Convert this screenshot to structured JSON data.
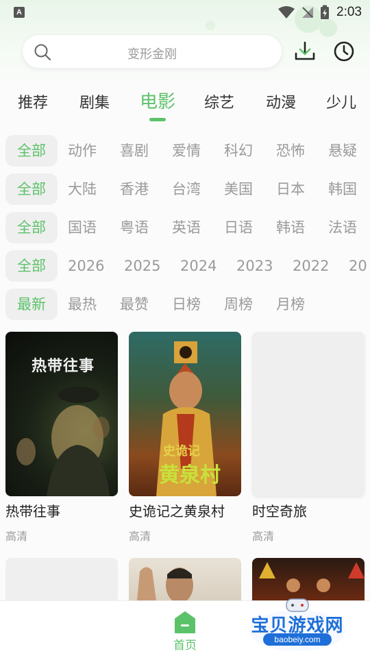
{
  "status_bar": {
    "time": "2:03"
  },
  "search": {
    "placeholder": "变形金刚"
  },
  "tabs": [
    {
      "label": "推荐"
    },
    {
      "label": "剧集"
    },
    {
      "label": "电影"
    },
    {
      "label": "综艺"
    },
    {
      "label": "动漫"
    },
    {
      "label": "少儿"
    }
  ],
  "active_tab": "电影",
  "filters": {
    "genre": [
      "全部",
      "动作",
      "喜剧",
      "爱情",
      "科幻",
      "恐怖",
      "悬疑"
    ],
    "region": [
      "全部",
      "大陆",
      "香港",
      "台湾",
      "美国",
      "日本",
      "韩国"
    ],
    "language": [
      "全部",
      "国语",
      "粤语",
      "英语",
      "日语",
      "韩语",
      "法语"
    ],
    "year": [
      "全部",
      "2026",
      "2025",
      "2024",
      "2023",
      "2022",
      "20"
    ],
    "sort": [
      "最新",
      "最热",
      "最赞",
      "日榜",
      "周榜",
      "月榜"
    ]
  },
  "movies": [
    {
      "title": "热带往事",
      "quality": "高清",
      "poster_text": "热带往事"
    },
    {
      "title": "史诡记之黄泉村",
      "quality": "高清",
      "poster_text_top": "史诡记",
      "poster_text_main": "黄泉村"
    },
    {
      "title": "时空奇旅",
      "quality": "高清"
    }
  ],
  "bottom_nav": {
    "home_label": "首页"
  },
  "watermark": {
    "title": "宝贝游戏网",
    "url": "baobeiy.com"
  },
  "colors": {
    "accent": "#5cc26a",
    "muted": "#9a9a9a"
  }
}
